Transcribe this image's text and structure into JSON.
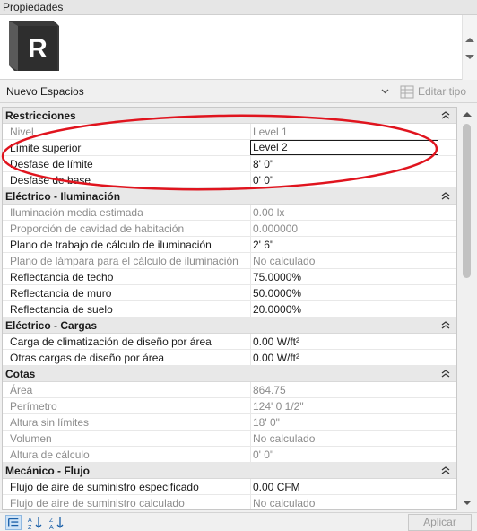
{
  "panel": {
    "title": "Propiedades"
  },
  "type_selector": {
    "icon": "revit-logo-icon",
    "icon_letter": "R",
    "selected": "Nuevo Espacios",
    "edit_type_label": "Editar tipo"
  },
  "properties": [
    {
      "group": "Restricciones",
      "rows": [
        {
          "name": "Nivel",
          "value": "Level 1",
          "disabled": true
        },
        {
          "name": "Límite superior",
          "value": "Level 2",
          "disabled": false,
          "editing": true
        },
        {
          "name": "Desfase de límite",
          "value": "8'  0\"",
          "disabled": false
        },
        {
          "name": "Desfase de base",
          "value": "0'  0\"",
          "disabled": false
        }
      ]
    },
    {
      "group": "Eléctrico - Iluminación",
      "rows": [
        {
          "name": "Iluminación media estimada",
          "value": "0.00 lx",
          "disabled": true
        },
        {
          "name": "Proporción de cavidad de habitación",
          "value": "0.000000",
          "disabled": true
        },
        {
          "name": "Plano de trabajo de cálculo de iluminación",
          "value": "2'  6\"",
          "disabled": false
        },
        {
          "name": "Plano de lámpara para el cálculo de iluminación",
          "value": "No calculado",
          "disabled": true
        },
        {
          "name": "Reflectancia de techo",
          "value": "75.0000%",
          "disabled": false
        },
        {
          "name": "Reflectancia de muro",
          "value": "50.0000%",
          "disabled": false
        },
        {
          "name": "Reflectancia de suelo",
          "value": "20.0000%",
          "disabled": false
        }
      ]
    },
    {
      "group": "Eléctrico - Cargas",
      "rows": [
        {
          "name": "Carga de climatización de diseño por área",
          "value": "0.00 W/ft²",
          "disabled": false
        },
        {
          "name": "Otras cargas de diseño por área",
          "value": "0.00 W/ft²",
          "disabled": false
        }
      ]
    },
    {
      "group": "Cotas",
      "rows": [
        {
          "name": "Área",
          "value": "864.75",
          "disabled": true
        },
        {
          "name": "Perímetro",
          "value": "124'  0 1/2\"",
          "disabled": true
        },
        {
          "name": "Altura sin límites",
          "value": "18'  0\"",
          "disabled": true
        },
        {
          "name": "Volumen",
          "value": "No calculado",
          "disabled": true
        },
        {
          "name": "Altura de cálculo",
          "value": "0'  0\"",
          "disabled": true
        }
      ]
    },
    {
      "group": "Mecánico - Flujo",
      "rows": [
        {
          "name": "Flujo de aire de suministro especificado",
          "value": "0.00 CFM",
          "disabled": false
        },
        {
          "name": "Flujo de aire de suministro calculado",
          "value": "No calculado",
          "disabled": true
        }
      ]
    }
  ],
  "footer": {
    "sort_icons": [
      "categorized-sort-icon",
      "sort-ascending-icon",
      "sort-descending-icon"
    ],
    "apply_label": "Aplicar"
  },
  "colors": {
    "annotation": "#e0141e",
    "group_bg": "#e8e8e8",
    "disabled_text": "#8c8c8c"
  }
}
